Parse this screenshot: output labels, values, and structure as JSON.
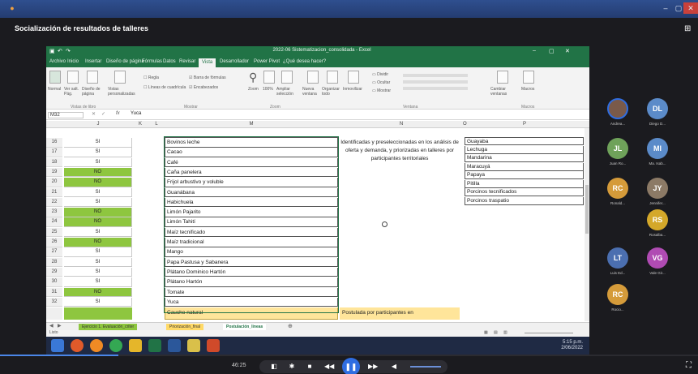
{
  "window": {
    "meeting_title": "Socialización de resultados de talleres"
  },
  "excel": {
    "title": "2022-06 Sistematizacion_consolidada - Excel",
    "ribbon_tabs": [
      "Archivo",
      "Inicio",
      "Insertar",
      "Diseño de página",
      "Fórmulas",
      "Datos",
      "Revisar",
      "Vista",
      "Desarrollador",
      "Power Pivot",
      "¿Qué desea hacer?"
    ],
    "active_tab": "Vista",
    "ribbon_groups": [
      "Vistas de libro",
      "Mostrar",
      "Zoom",
      "Ventana",
      "Macros"
    ],
    "ribbon_buttons": {
      "normal": "Normal",
      "ver_salto": "Ver salt. Pág.",
      "diseno": "Diseño de página",
      "vistas": "Vistas personalizadas",
      "regla": "Regla",
      "barra_formulas": "Barra de fórmulas",
      "lineas": "Líneas de cuadrícula",
      "encabezados": "Encabezados",
      "zoom": "Zoom",
      "zoom100": "100%",
      "ampliar": "Ampliar selección",
      "nueva": "Nueva ventana",
      "organizar": "Organizar todo",
      "inmovilizar": "Inmovilizar",
      "dividir": "Dividir",
      "ocultar": "Ocultar",
      "mostrar": "Mostrar",
      "cambiar": "Cambiar ventanas",
      "macros": "Macros"
    },
    "name_box": "M32",
    "formula_value": "Yuca",
    "columns": [
      "J",
      "K",
      "L",
      "M",
      "N",
      "O",
      "P"
    ],
    "rows": [
      {
        "n": "16",
        "j": "SI",
        "jg": false,
        "m": "Bovinos leche"
      },
      {
        "n": "17",
        "j": "SI",
        "jg": false,
        "m": "Cacao"
      },
      {
        "n": "18",
        "j": "SI",
        "jg": false,
        "m": "Café"
      },
      {
        "n": "19",
        "j": "NO",
        "jg": true,
        "m": "Caña panelera"
      },
      {
        "n": "20",
        "j": "NO",
        "jg": true,
        "m": "Frijol arbustivo y voluble"
      },
      {
        "n": "21",
        "j": "SI",
        "jg": false,
        "m": "Guanábana"
      },
      {
        "n": "22",
        "j": "SI",
        "jg": false,
        "m": "Habichuela"
      },
      {
        "n": "23",
        "j": "NO",
        "jg": true,
        "m": "Limón Pajarito"
      },
      {
        "n": "24",
        "j": "NO",
        "jg": true,
        "m": "Limón Tahití"
      },
      {
        "n": "25",
        "j": "SI",
        "jg": false,
        "m": "Maíz tecnificado"
      },
      {
        "n": "26",
        "j": "NO",
        "jg": true,
        "m": "Maíz tradicional"
      },
      {
        "n": "27",
        "j": "SI",
        "jg": false,
        "m": "Mango"
      },
      {
        "n": "28",
        "j": "SI",
        "jg": false,
        "m": "Papa Pastusa y Sabanera"
      },
      {
        "n": "29",
        "j": "SI",
        "jg": false,
        "m": "Plátano Dominico Hartón"
      },
      {
        "n": "30",
        "j": "SI",
        "jg": false,
        "m": "Plátano Hartón"
      },
      {
        "n": "31",
        "j": "NO",
        "jg": true,
        "m": "Tomate"
      },
      {
        "n": "32",
        "j": "SI",
        "jg": false,
        "m": "Yuca"
      }
    ],
    "last_row_m": "Caucho natural",
    "n_text": "Identificadas y preseleccionadas en los análisis de oferta y demanda, y priorizadas en talleres por participantes territoriales",
    "n_yellow": "Postulada por participantes en",
    "p_items": [
      "Guayaba",
      "Lechuga",
      "Mandarina",
      "Maracuyá",
      "Papaya",
      "Pitilla",
      "Porcinos tecnificados",
      "Porcinos traspatio"
    ],
    "sheet_tabs": [
      {
        "label": "Ejercicio 1. Evaluación_criter",
        "color": "#8ec63f",
        "active": false
      },
      {
        "label": "Priorización_final",
        "color": "#ffd966",
        "active": false
      },
      {
        "label": "Postulación_lineas",
        "color": "#ffffff",
        "active": true
      }
    ],
    "status_text": "Listo"
  },
  "taskbar": {
    "time": "5:15 p.m.",
    "date": "2/06/2022"
  },
  "participants": [
    {
      "initials": "",
      "name": "Andrea...",
      "color": "#7a5a4a",
      "photo": true
    },
    {
      "initials": "DL",
      "name": "Diego D...",
      "color": "#5b8bc9"
    },
    {
      "initials": "JL",
      "name": "Juan Ro...",
      "color": "#6fa25a"
    },
    {
      "initials": "MI",
      "name": "Ma. Isab...",
      "color": "#5b8bc9"
    },
    {
      "initials": "RC",
      "name": "Ronald...",
      "color": "#d59b3a"
    },
    {
      "initials": "JY",
      "name": "Jennifer...",
      "color": "#8c7a66"
    },
    {
      "initials": "RS",
      "name": "Rosalba...",
      "color": "#d4a82a"
    },
    {
      "initials": "LT",
      "name": "Luis Ed...",
      "color": "#4b6fb0"
    },
    {
      "initials": "VG",
      "name": "Vale Gir...",
      "color": "#b04bb3"
    },
    {
      "initials": "RC",
      "name": "Rocio...",
      "color": "#d59b3a"
    }
  ],
  "player": {
    "elapsed": "46:25",
    "progress": 0.17
  },
  "colors": {
    "excel_green": "#217346",
    "accent_blue": "#2f6de1",
    "cell_green": "#8ec63f",
    "cell_yellow": "#ffe59a"
  }
}
